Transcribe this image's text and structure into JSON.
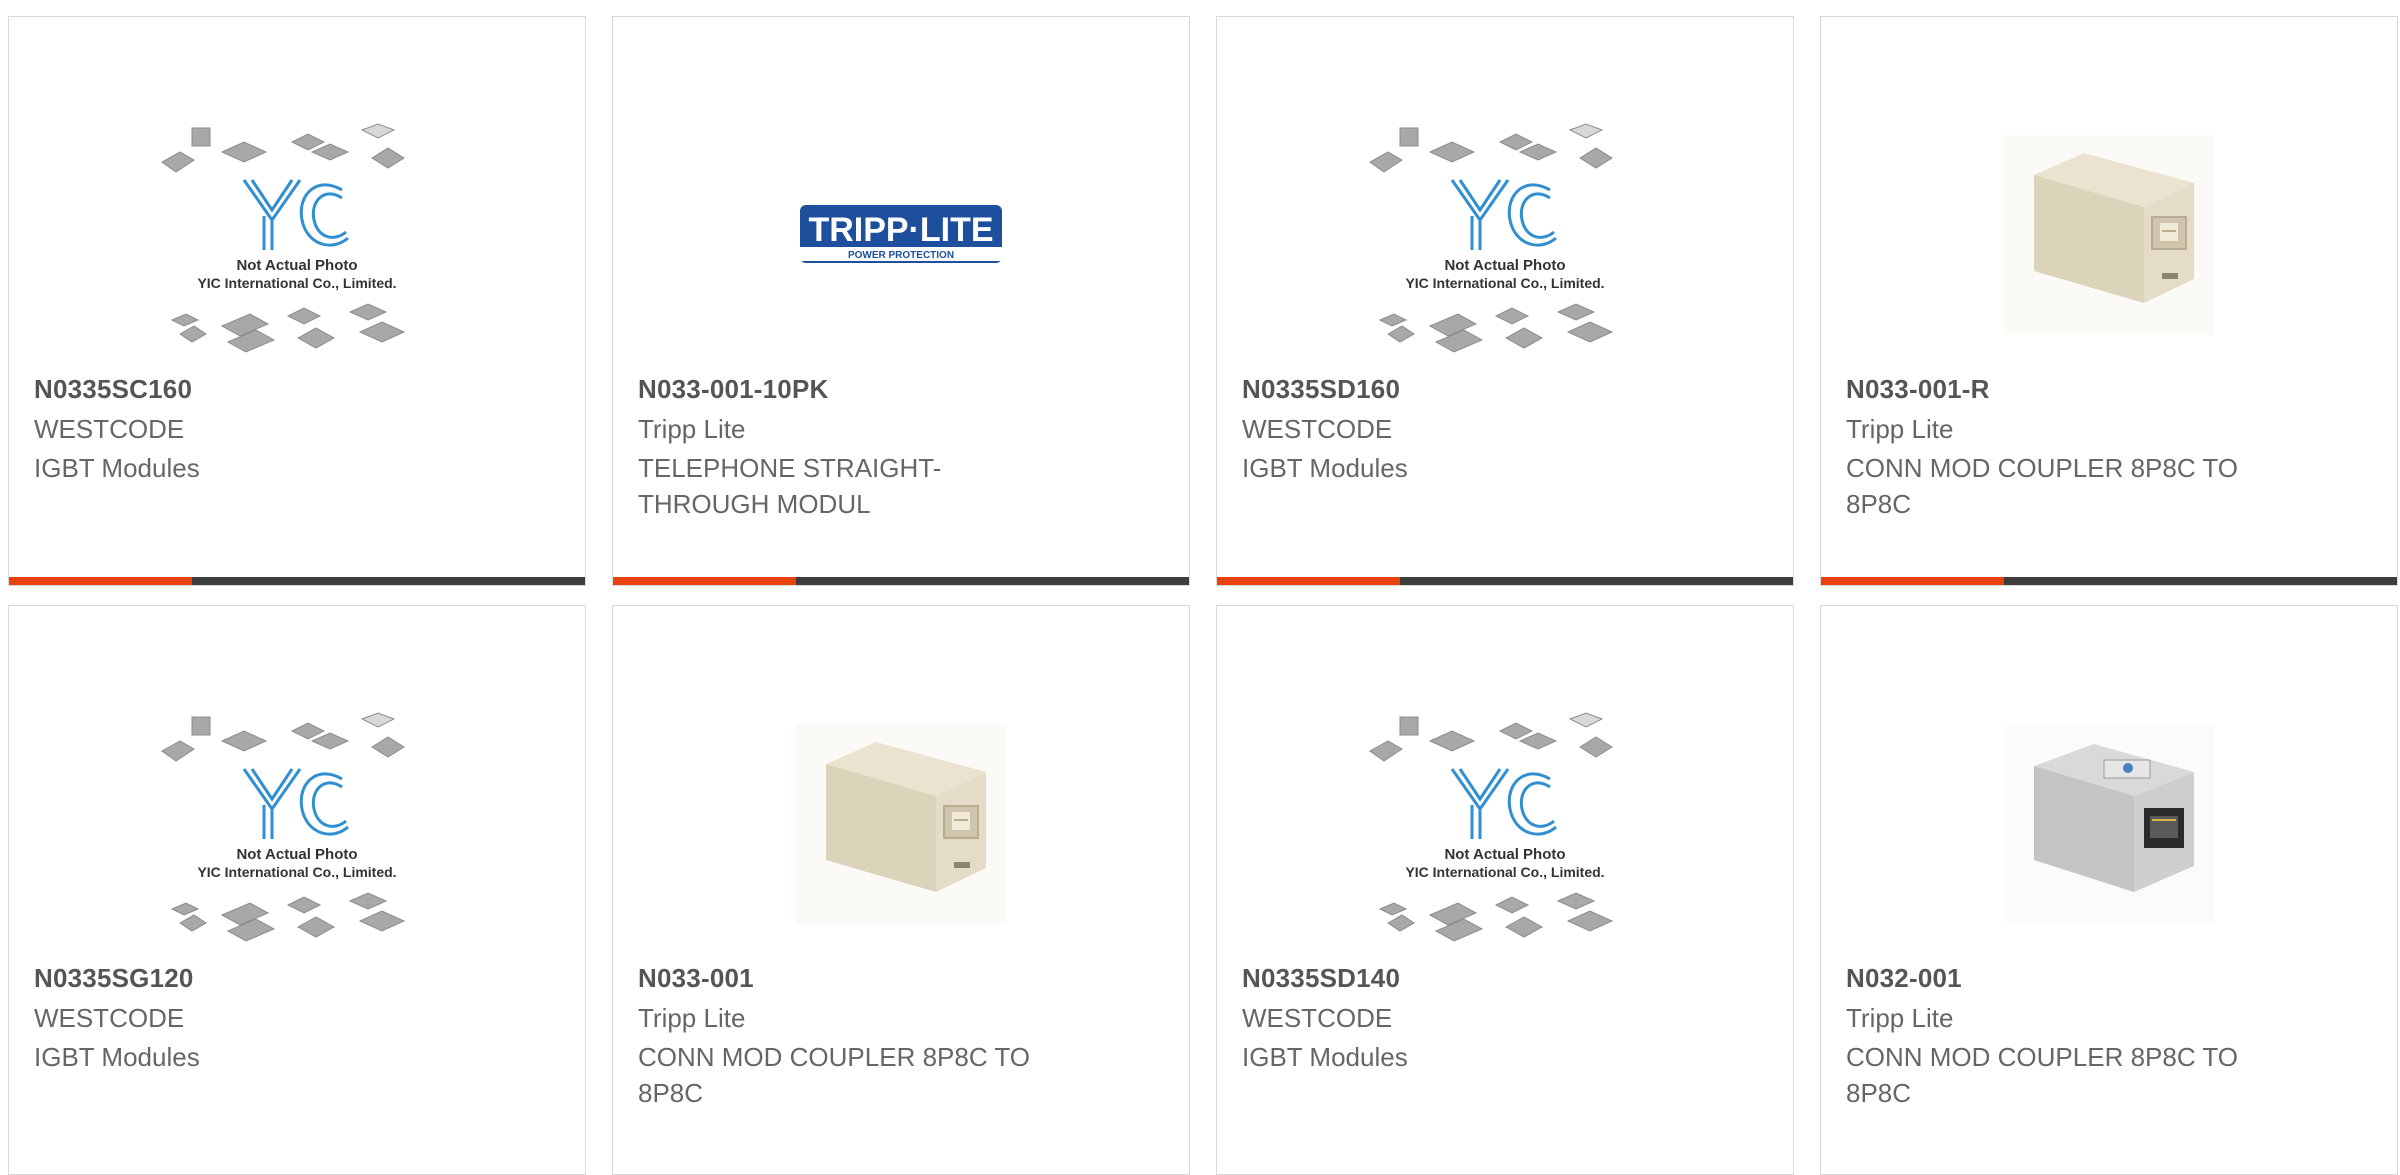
{
  "colors": {
    "accent": "#e8420c",
    "bar": "#3d3d3d",
    "border": "#d9d9d9",
    "text": "#666666",
    "part_number": "#555555",
    "tripp_blue": "#1d4f9c",
    "yic_blue": "#2f8fd0"
  },
  "placeholder": {
    "brand": "YIC",
    "line1": "Not Actual Photo",
    "line2": "YIC International Co., Limited."
  },
  "tripp_logo": {
    "brand": "TRIPP·LITE",
    "tagline": "POWER PROTECTION"
  },
  "products": [
    {
      "part_number": "N0335SC160",
      "manufacturer": "WESTCODE",
      "description": "IGBT Modules",
      "image": "yic-placeholder"
    },
    {
      "part_number": "N033-001-10PK",
      "manufacturer": "Tripp Lite",
      "description": "TELEPHONE STRAIGHT-THROUGH MODUL",
      "image": "tripp-lite-logo"
    },
    {
      "part_number": "N0335SD160",
      "manufacturer": "WESTCODE",
      "description": "IGBT Modules",
      "image": "yic-placeholder"
    },
    {
      "part_number": "N033-001-R",
      "manufacturer": "Tripp Lite",
      "description": "CONN MOD COUPLER 8P8C TO 8P8C",
      "image": "beige-coupler"
    },
    {
      "part_number": "N0335SG120",
      "manufacturer": "WESTCODE",
      "description": "IGBT Modules",
      "image": "yic-placeholder"
    },
    {
      "part_number": "N033-001",
      "manufacturer": "Tripp Lite",
      "description": "CONN MOD COUPLER 8P8C TO 8P8C",
      "image": "beige-coupler"
    },
    {
      "part_number": "N0335SD140",
      "manufacturer": "WESTCODE",
      "description": "IGBT Modules",
      "image": "yic-placeholder"
    },
    {
      "part_number": "N032-001",
      "manufacturer": "Tripp Lite",
      "description": "CONN MOD COUPLER 8P8C TO 8P8C",
      "image": "shielded-coupler"
    }
  ]
}
